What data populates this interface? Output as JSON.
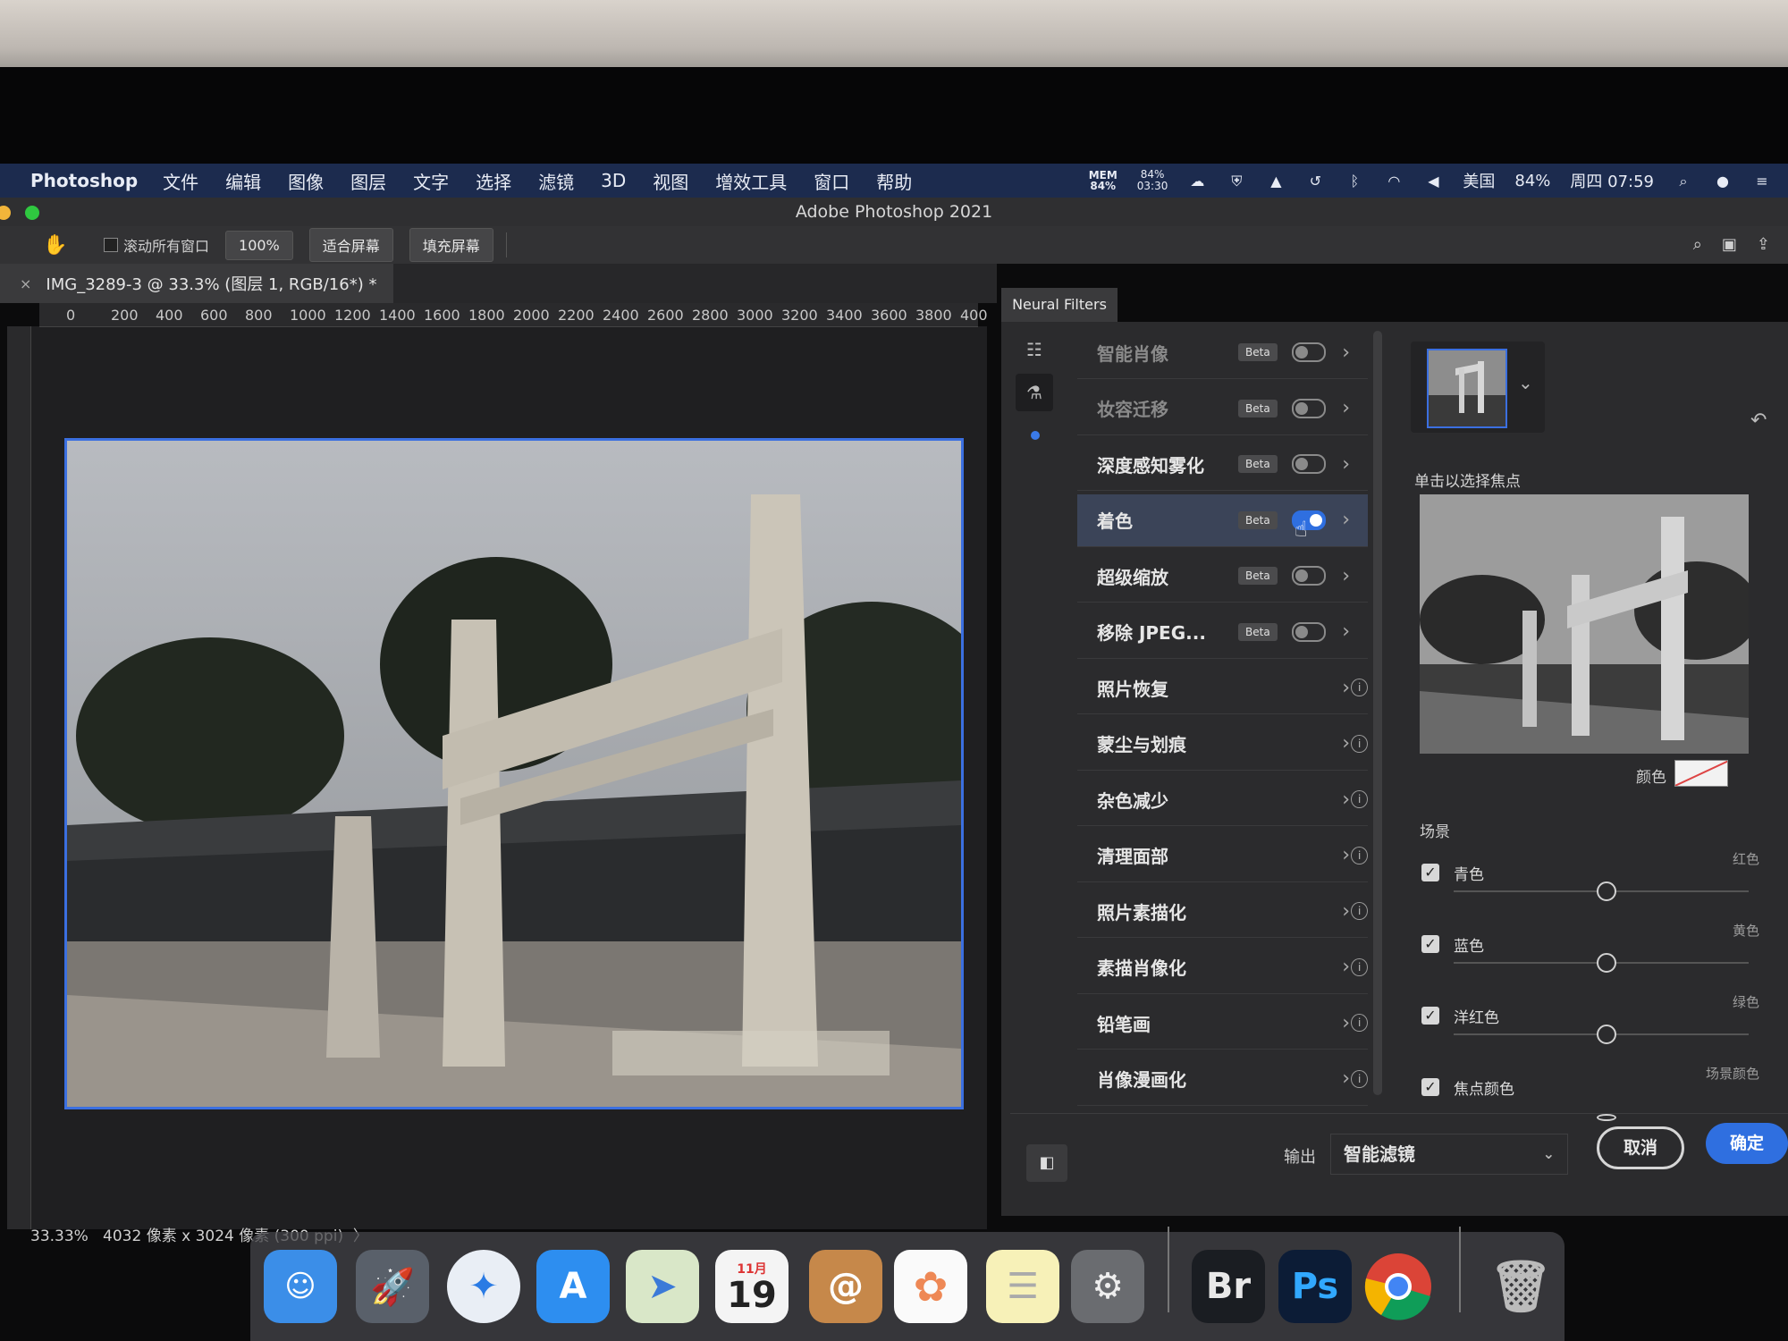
{
  "menubar": {
    "app": "Photoshop",
    "items": [
      "文件",
      "编辑",
      "图像",
      "图层",
      "文字",
      "选择",
      "滤镜",
      "3D",
      "视图",
      "增效工具",
      "窗口",
      "帮助"
    ],
    "status": {
      "mem_label": "MEM",
      "mem_value": "84%",
      "battery_top": "84%",
      "battery_bottom": "03:30",
      "region": "美国",
      "battery": "84%",
      "clock": "周四 07:59"
    }
  },
  "window": {
    "title": "Adobe Photoshop 2021"
  },
  "options": {
    "scroll_all": "滚动所有窗口",
    "zoom": "100%",
    "fit": "适合屏幕",
    "fill": "填充屏幕"
  },
  "document": {
    "tab": "IMG_3289-3 @ 33.3% (图层 1, RGB/16*) *",
    "ruler_h": [
      "0",
      "200",
      "400",
      "600",
      "800",
      "1000",
      "1200",
      "1400",
      "1600",
      "1800",
      "2000",
      "2200",
      "2400",
      "2600",
      "2800",
      "3000",
      "3200",
      "3400",
      "3600",
      "3800",
      "400"
    ],
    "zoom_status": "33.33%",
    "size_status": "4032 像素 x 3024 像素 (300 ppi)",
    "status_chevron": "〉"
  },
  "neural_filters": {
    "tab_label": "Neural Filters",
    "filters": [
      {
        "name": "智能肖像",
        "badge": "Beta",
        "type": "toggle",
        "on": false,
        "dim": true
      },
      {
        "name": "妆容迁移",
        "badge": "Beta",
        "type": "toggle",
        "on": false,
        "dim": true
      },
      {
        "name": "深度感知雾化",
        "badge": "Beta",
        "type": "toggle",
        "on": false,
        "dim": false
      },
      {
        "name": "着色",
        "badge": "Beta",
        "type": "toggle",
        "on": true,
        "dim": false
      },
      {
        "name": "超级缩放",
        "badge": "Beta",
        "type": "toggle",
        "on": false,
        "dim": false
      },
      {
        "name": "移除 JPEG...",
        "badge": "Beta",
        "type": "toggle",
        "on": false,
        "dim": false
      },
      {
        "name": "照片恢复",
        "badge": "",
        "type": "info",
        "on": false,
        "dim": false
      },
      {
        "name": "蒙尘与划痕",
        "badge": "",
        "type": "info",
        "on": false,
        "dim": false
      },
      {
        "name": "杂色减少",
        "badge": "",
        "type": "info",
        "on": false,
        "dim": false
      },
      {
        "name": "清理面部",
        "badge": "",
        "type": "info",
        "on": false,
        "dim": false
      },
      {
        "name": "照片素描化",
        "badge": "",
        "type": "info",
        "on": false,
        "dim": false
      },
      {
        "name": "素描肖像化",
        "badge": "",
        "type": "info",
        "on": false,
        "dim": false
      },
      {
        "name": "铅笔画",
        "badge": "",
        "type": "info",
        "on": false,
        "dim": false
      },
      {
        "name": "肖像漫画化",
        "badge": "",
        "type": "info",
        "on": false,
        "dim": false
      }
    ],
    "settings": {
      "focus_label": "单击以选择焦点",
      "color_label": "颜色",
      "scene_label": "场景",
      "sliders": [
        {
          "left": "青色",
          "right": "红色",
          "checked": true,
          "value": 0.5
        },
        {
          "left": "蓝色",
          "right": "黄色",
          "checked": true,
          "value": 0.5
        },
        {
          "left": "洋红色",
          "right": "绿色",
          "checked": true,
          "value": 0.5
        },
        {
          "left": "焦点颜色",
          "right": "场景颜色",
          "checked": true,
          "value": 0.5
        }
      ]
    },
    "output_label": "输出",
    "output_value": "智能滤镜",
    "cancel": "取消",
    "ok": "确定"
  },
  "dock": {
    "apps": [
      "Finder",
      "Launchpad",
      "Safari",
      "App Store",
      "Maps",
      "Calendar",
      "Contacts",
      "Photos",
      "Notes",
      "System Preferences",
      "Br",
      "Ps",
      "Chrome",
      "Trash"
    ],
    "calendar_month": "11月",
    "calendar_day": "19",
    "bridge_label": "Br",
    "ps_label": "Ps"
  }
}
